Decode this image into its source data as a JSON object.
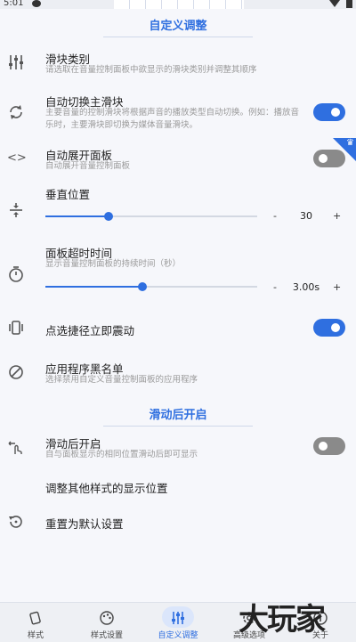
{
  "status": {
    "time": "5:01"
  },
  "header": {
    "title": "自定义调整"
  },
  "items": {
    "slider_category": {
      "title": "滑块类别",
      "sub": "请选取在音量控制面板中欲显示的滑块类别并调整其顺序"
    },
    "auto_switch": {
      "title": "自动切换主滑块",
      "sub": "主要音量的控制滑块将根据声音的播放类型自动切换。例如：播放音乐时，主要滑块即切换为媒体音量滑块。",
      "on": true
    },
    "auto_expand": {
      "title": "自动展开面板",
      "sub": "自动展开音量控制面板",
      "on": false
    },
    "vertical_pos": {
      "title": "垂直位置",
      "minus": "-",
      "plus": "+",
      "value": "30",
      "fraction": 0.3
    },
    "timeout": {
      "title": "面板超时时间",
      "sub": "显示音量控制面板的持续时间（秒）",
      "minus": "-",
      "plus": "+",
      "value": "3.00s",
      "fraction": 0.46
    },
    "vibrate": {
      "title": "点选捷径立即震动",
      "on": true
    },
    "blacklist": {
      "title": "应用程序黑名单",
      "sub": "选择禁用自定义音量控制面板的应用程序"
    }
  },
  "swipe_section": {
    "title": "滑动后开启"
  },
  "swipe": {
    "open": {
      "title": "滑动后开启",
      "sub": "自与面板显示的相同位置滑动后即可显示",
      "on": false
    },
    "adjust": {
      "title": "调整其他样式的显示位置"
    },
    "reset": {
      "title": "重置为默认设置"
    }
  },
  "tabs": [
    {
      "label": "样式",
      "icon": "style-icon"
    },
    {
      "label": "样式设置",
      "icon": "palette-icon"
    },
    {
      "label": "自定义调整",
      "icon": "sliders-icon",
      "active": true
    },
    {
      "label": "高级选项",
      "icon": "gear-icon"
    },
    {
      "label": "关于",
      "icon": "info-icon"
    }
  ],
  "watermark": "大玩家",
  "colors": {
    "accent": "#2f6fe0",
    "toggle_off": "#8a8a8a",
    "background": "#f6f7fb"
  }
}
